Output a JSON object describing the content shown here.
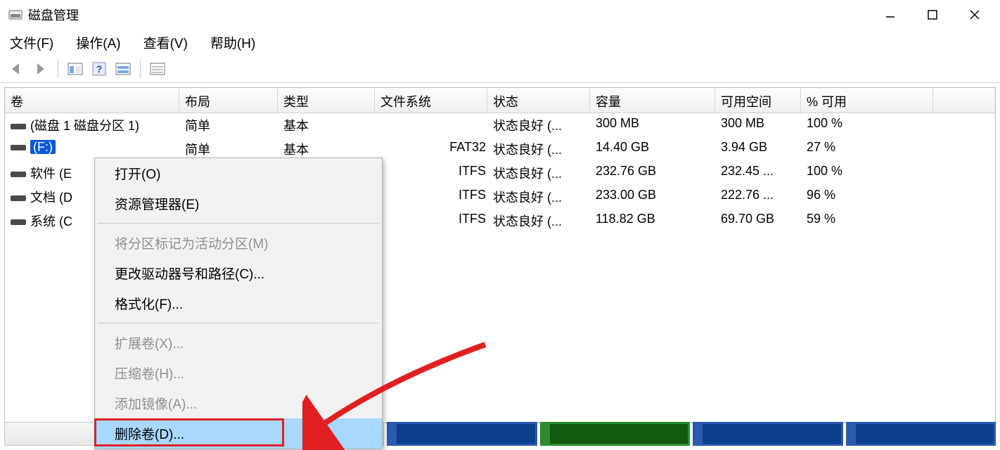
{
  "window": {
    "title": "磁盘管理"
  },
  "menu": {
    "file": "文件(F)",
    "action": "操作(A)",
    "view": "查看(V)",
    "help": "帮助(H)"
  },
  "columns": {
    "volume": "卷",
    "layout": "布局",
    "type": "类型",
    "fs": "文件系统",
    "status": "状态",
    "capacity": "容量",
    "free": "可用空间",
    "pct": "% 可用"
  },
  "rows": [
    {
      "volume": "(磁盘 1 磁盘分区 1)",
      "layout": "简单",
      "type": "基本",
      "fs": "",
      "status": "状态良好 (...",
      "capacity": "300 MB",
      "free": "300 MB",
      "pct": "100 %"
    },
    {
      "volume": "(F:)",
      "layout": "简单",
      "type": "基本",
      "fs": "FAT32",
      "status": "状态良好 (...",
      "capacity": "14.40 GB",
      "free": "3.94 GB",
      "pct": "27 %"
    },
    {
      "volume": "软件 (E",
      "layout": "",
      "type": "",
      "fs": "ITFS",
      "status": "状态良好 (...",
      "capacity": "232.76 GB",
      "free": "232.45 ...",
      "pct": "100 %"
    },
    {
      "volume": "文档 (D",
      "layout": "",
      "type": "",
      "fs": "ITFS",
      "status": "状态良好 (...",
      "capacity": "233.00 GB",
      "free": "222.76 ...",
      "pct": "96 %"
    },
    {
      "volume": "系统 (C",
      "layout": "",
      "type": "",
      "fs": "ITFS",
      "status": "状态良好 (...",
      "capacity": "118.82 GB",
      "free": "69.70 GB",
      "pct": "59 %"
    }
  ],
  "context_menu": {
    "open": "打开(O)",
    "explorer": "资源管理器(E)",
    "mark_active": "将分区标记为活动分区(M)",
    "change_letter": "更改驱动器号和路径(C)...",
    "format": "格式化(F)...",
    "extend": "扩展卷(X)...",
    "shrink": "压缩卷(H)...",
    "mirror": "添加镜像(A)...",
    "delete": "删除卷(D)..."
  }
}
